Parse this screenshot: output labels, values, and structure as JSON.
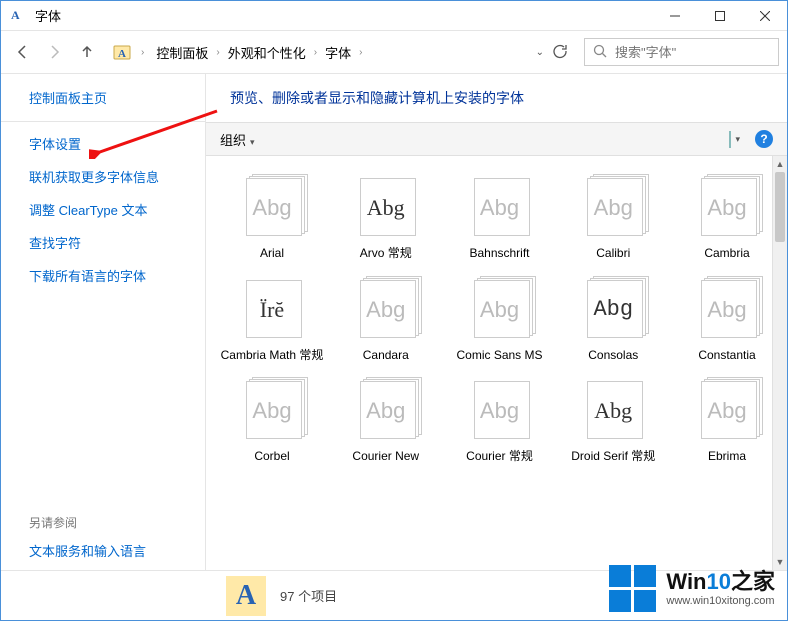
{
  "window": {
    "title": "字体"
  },
  "breadcrumb": {
    "items": [
      "控制面板",
      "外观和个性化",
      "字体"
    ]
  },
  "search": {
    "placeholder": "搜索\"字体\""
  },
  "sidebar": {
    "home": "控制面板主页",
    "links": [
      "字体设置",
      "联机获取更多字体信息",
      "调整 ClearType 文本",
      "查找字符",
      "下载所有语言的字体"
    ],
    "seeAlsoHeading": "另请参阅",
    "seeAlsoLinks": [
      "文本服务和输入语言"
    ]
  },
  "content": {
    "heading": "预览、删除或者显示和隐藏计算机上安装的字体",
    "toolbar": {
      "organize": "组织"
    }
  },
  "fonts": [
    {
      "label": "Arial",
      "glyph": "Abg",
      "dim": true,
      "stack": true
    },
    {
      "label": "Arvo 常规",
      "glyph": "Abg",
      "dim": false,
      "stack": false,
      "serif": true
    },
    {
      "label": "Bahnschrift",
      "glyph": "Abg",
      "dim": true,
      "stack": false
    },
    {
      "label": "Calibri",
      "glyph": "Abg",
      "dim": true,
      "stack": true
    },
    {
      "label": "Cambria",
      "glyph": "Abg",
      "dim": true,
      "stack": true
    },
    {
      "label": "Cambria Math 常规",
      "glyph": "Ïrĕ",
      "dim": false,
      "stack": false,
      "serif": true
    },
    {
      "label": "Candara",
      "glyph": "Abg",
      "dim": true,
      "stack": true
    },
    {
      "label": "Comic Sans MS",
      "glyph": "Abg",
      "dim": true,
      "stack": true
    },
    {
      "label": "Consolas",
      "glyph": "Abg",
      "dim": false,
      "stack": true,
      "mono": true
    },
    {
      "label": "Constantia",
      "glyph": "Abg",
      "dim": true,
      "stack": true
    },
    {
      "label": "Corbel",
      "glyph": "Abg",
      "dim": true,
      "stack": true
    },
    {
      "label": "Courier New",
      "glyph": "Abg",
      "dim": true,
      "stack": true
    },
    {
      "label": "Courier 常规",
      "glyph": "Abg",
      "dim": true,
      "stack": false
    },
    {
      "label": "Droid Serif 常规",
      "glyph": "Abg",
      "dim": false,
      "stack": false,
      "serif": true
    },
    {
      "label": "Ebrima",
      "glyph": "Abg",
      "dim": true,
      "stack": true
    }
  ],
  "status": {
    "count": "97 个项目"
  },
  "watermark": {
    "brandA": "Win",
    "brandB": "10",
    "brandC": "之家",
    "url": "www.win10xitong.com"
  }
}
